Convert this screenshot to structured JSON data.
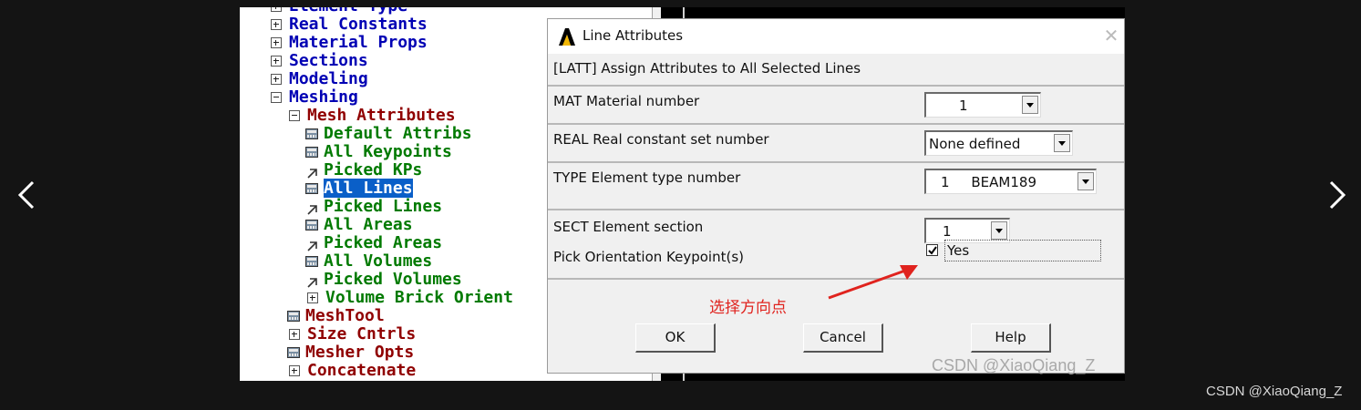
{
  "viewer": {
    "watermark": "CSDN @XiaoQiang_Z",
    "prev_icon": "chevron-left-icon",
    "next_icon": "chevron-right-icon"
  },
  "tree": {
    "items": [
      {
        "label": "Element Type",
        "toggle": "plus",
        "color": "blue"
      },
      {
        "label": "Real Constants",
        "toggle": "plus",
        "color": "blue"
      },
      {
        "label": "Material Props",
        "toggle": "plus",
        "color": "blue"
      },
      {
        "label": "Sections",
        "toggle": "plus",
        "color": "blue"
      },
      {
        "label": "Modeling",
        "toggle": "plus",
        "color": "blue"
      },
      {
        "label": "Meshing",
        "toggle": "minus",
        "color": "blue"
      },
      {
        "label": "Mesh Attributes",
        "toggle": "minus",
        "color": "red"
      },
      {
        "label": "Default Attribs",
        "icon": "grid-icon",
        "color": "green"
      },
      {
        "label": "All Keypoints",
        "icon": "grid-icon",
        "color": "green"
      },
      {
        "label": "Picked KPs",
        "icon": "pick-arrow-icon",
        "color": "green"
      },
      {
        "label": "All Lines",
        "icon": "grid-icon",
        "color": "green",
        "selected": true
      },
      {
        "label": "Picked Lines",
        "icon": "pick-arrow-icon",
        "color": "green"
      },
      {
        "label": "All Areas",
        "icon": "grid-icon",
        "color": "green"
      },
      {
        "label": "Picked Areas",
        "icon": "pick-arrow-icon",
        "color": "green"
      },
      {
        "label": "All Volumes",
        "icon": "grid-icon",
        "color": "green"
      },
      {
        "label": "Picked Volumes",
        "icon": "pick-arrow-icon",
        "color": "green"
      },
      {
        "label": "Volume Brick Orient",
        "toggle": "plus",
        "color": "green"
      },
      {
        "label": "MeshTool",
        "icon": "grid-icon",
        "color": "red"
      },
      {
        "label": "Size Cntrls",
        "toggle": "plus",
        "color": "red"
      },
      {
        "label": "Mesher Opts",
        "icon": "grid-icon",
        "color": "red"
      },
      {
        "label": "Concatenate",
        "toggle": "plus",
        "color": "red"
      }
    ]
  },
  "dialog": {
    "title": "Line Attributes",
    "app_icon": "ansys-logo-icon",
    "close_icon": "close-icon",
    "header": "[LATT]  Assign Attributes to All Selected Lines",
    "mat": {
      "label": "MAT   Material number",
      "value": "1"
    },
    "real": {
      "label": "REAL  Real constant set number",
      "value": "None defined"
    },
    "type": {
      "label": "TYPE  Element type number",
      "value": "1     BEAM189"
    },
    "sect": {
      "label": "SECT  Element section",
      "value": "1"
    },
    "pick": {
      "label": "Pick Orientation Keypoint(s)",
      "checked": true,
      "value": "Yes"
    },
    "annotation": "选择方向点",
    "buttons": {
      "ok": "OK",
      "cancel": "Cancel",
      "help": "Help"
    },
    "watermark": "CSDN @XiaoQiang_Z"
  },
  "colors": {
    "tree_blue": "#0000b4",
    "tree_red": "#900000",
    "tree_green": "#007a00",
    "selection": "#0a5fc8",
    "annotation": "#e0231e"
  }
}
